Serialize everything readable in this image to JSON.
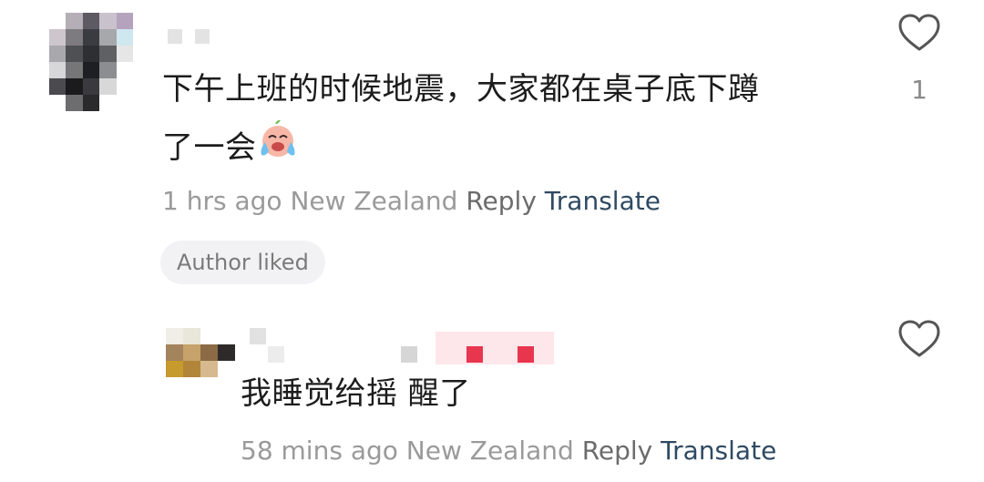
{
  "comments": [
    {
      "text_line1": "下午上班的时候地震，大家都在桌子底下蹲",
      "text_line2": "了一会",
      "emoji": "laughing-crying-emoji",
      "time": "1 hrs ago",
      "location": "New Zealand",
      "reply_label": "Reply",
      "translate_label": "Translate",
      "badge": "Author liked",
      "like_count": "1"
    },
    {
      "text": "我睡觉给摇 醒了",
      "time": "58 mins ago",
      "location": "New Zealand",
      "reply_label": "Reply",
      "translate_label": "Translate",
      "like_count": ""
    }
  ],
  "icons": {
    "like": "heart-outline-icon"
  },
  "colors": {
    "translate": "#2f4a63",
    "meta": "#9a9a9a",
    "badge_bg": "#f2f2f4"
  }
}
